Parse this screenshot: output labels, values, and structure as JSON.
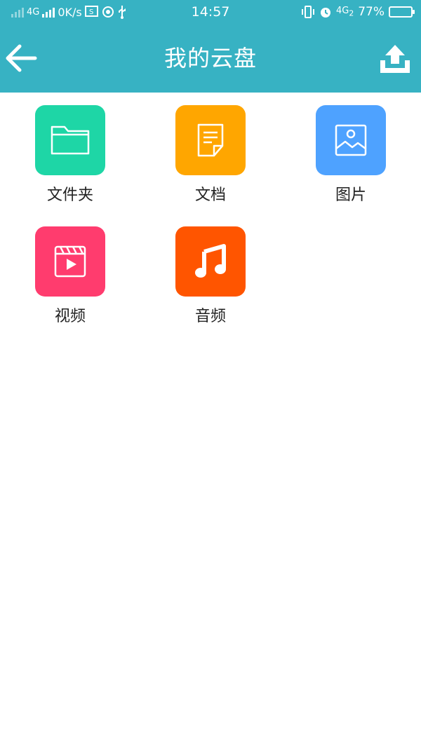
{
  "status_bar": {
    "network_left": "4G",
    "speed": "0K/s",
    "time": "14:57",
    "network_right": "4G",
    "sim_index": "2",
    "battery_percent": "77%",
    "battery_level": 0.77
  },
  "header": {
    "title": "我的云盘",
    "back_icon": "arrow-left-icon",
    "upload_icon": "upload-icon"
  },
  "colors": {
    "header": "#37b2c3",
    "folder": "#1ed6a6",
    "document": "#ffa600",
    "image": "#4ea2ff",
    "video": "#ff3c6e",
    "audio": "#ff5500"
  },
  "categories": [
    {
      "label": "文件夹",
      "icon": "folder-icon"
    },
    {
      "label": "文档",
      "icon": "document-icon"
    },
    {
      "label": "图片",
      "icon": "image-icon"
    },
    {
      "label": "视频",
      "icon": "video-icon"
    },
    {
      "label": "音频",
      "icon": "music-icon"
    }
  ]
}
